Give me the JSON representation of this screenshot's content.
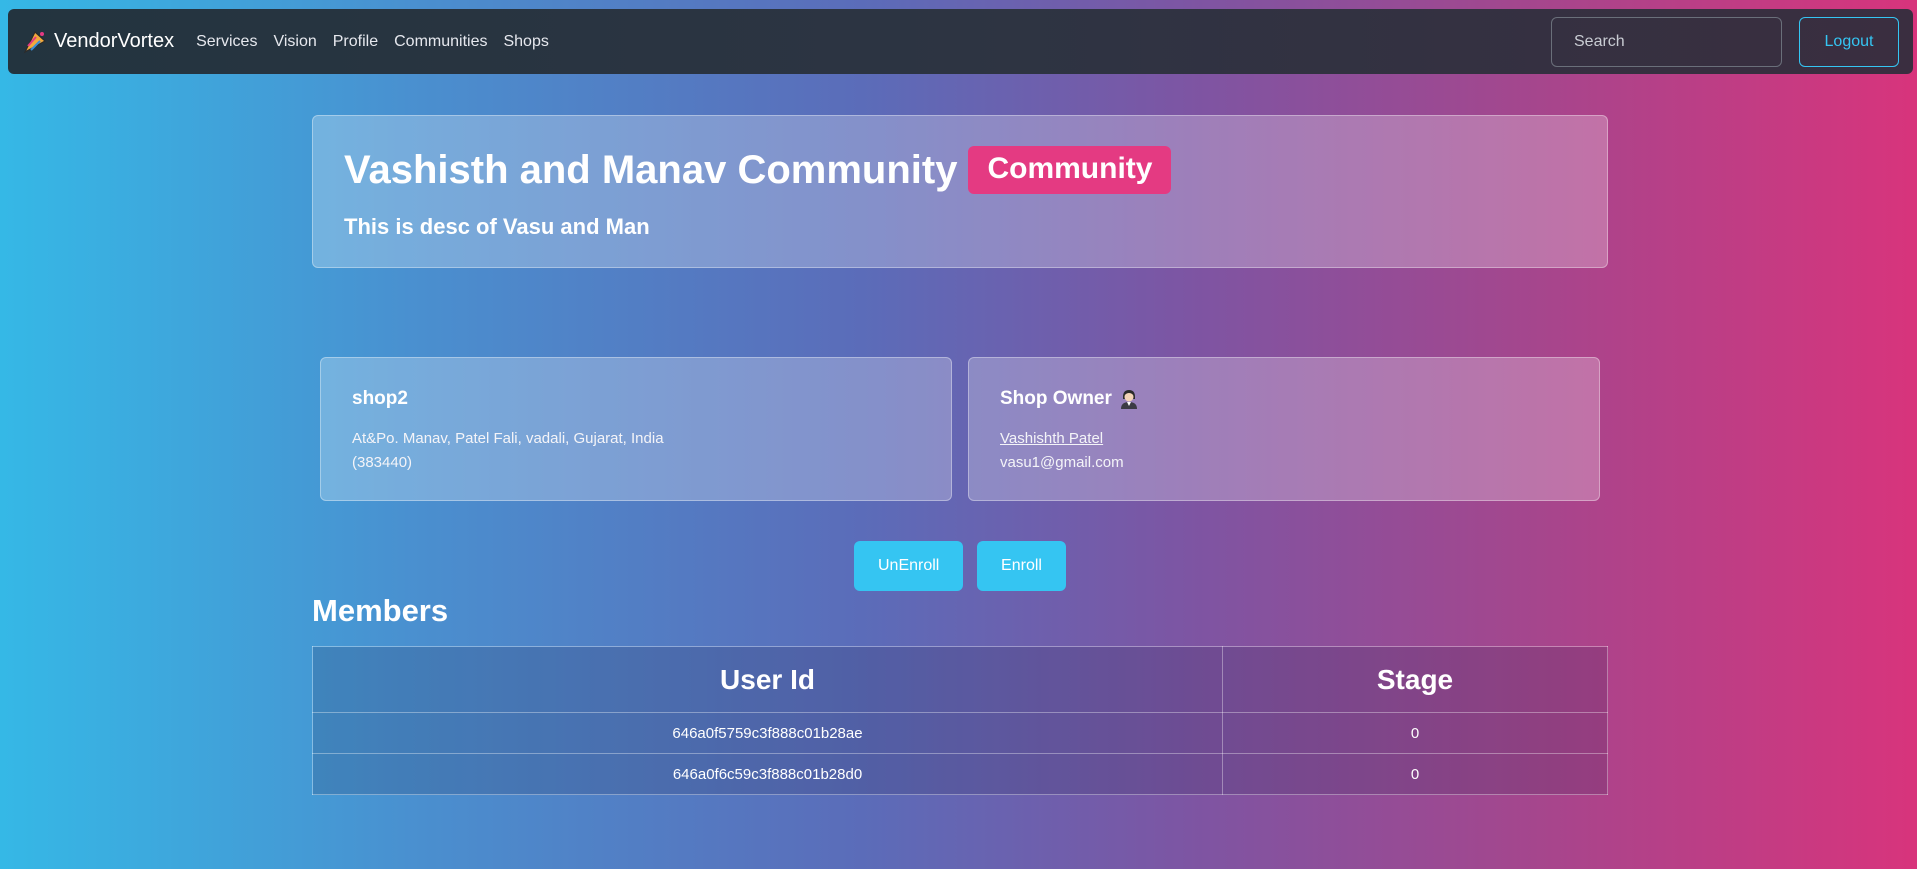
{
  "nav": {
    "brand": "VendorVortex",
    "links": [
      "Services",
      "Vision",
      "Profile",
      "Communities",
      "Shops"
    ],
    "search_placeholder": "Search",
    "logout_label": "Logout"
  },
  "header": {
    "title": "Vashisth and Manav Community",
    "badge": "Community",
    "description": "This is desc of Vasu and Man"
  },
  "shop_card": {
    "title": "shop2",
    "address_line1": "At&Po. Manav, Patel Fali, vadali, Gujarat, India",
    "address_line2": "(383440)"
  },
  "owner_card": {
    "title": "Shop Owner",
    "owner_name": "Vashishth Patel",
    "owner_email": "vasu1@gmail.com"
  },
  "actions": {
    "unenroll_label": "UnEnroll",
    "enroll_label": "Enroll"
  },
  "members": {
    "heading": "Members",
    "columns": [
      "User Id",
      "Stage"
    ],
    "rows": [
      {
        "user_id": "646a0f5759c3f888c01b28ae",
        "stage": "0"
      },
      {
        "user_id": "646a0f6c59c3f888c01b28d0",
        "stage": "0"
      }
    ]
  },
  "colors": {
    "accent": "#35c5f2",
    "badge": "#e43a82",
    "navbar": "#2d3442"
  },
  "icons": {
    "brand": "vortex-logo-icon",
    "owner": "person-icon"
  }
}
